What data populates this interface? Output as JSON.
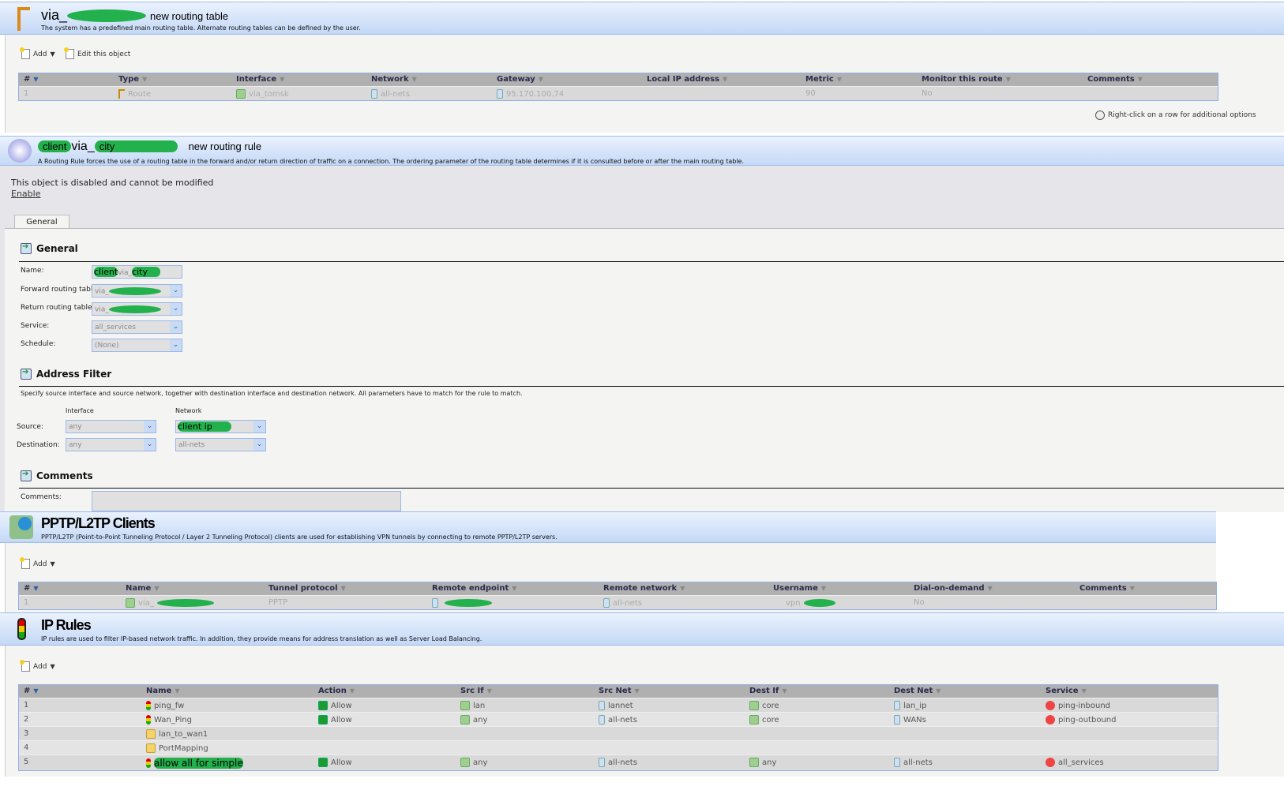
{
  "routing_table": {
    "title_prefix": "via_",
    "title_suffix": "new routing table",
    "description": "The system has a predefined main routing table. Alternate routing tables can be defined by the user.",
    "toolbar": {
      "add": "Add",
      "edit": "Edit this object"
    },
    "columns": [
      "#",
      "Type",
      "Interface",
      "Network",
      "Gateway",
      "Local IP address",
      "Metric",
      "Monitor this route",
      "Comments"
    ],
    "rows": [
      [
        "1",
        "Route",
        "via_tomsk",
        "all-nets",
        "95.170.100.74",
        "",
        "90",
        "No",
        ""
      ]
    ],
    "hint": "Right-click on a row for additional options"
  },
  "routing_rule": {
    "title_a": "client",
    "title_b": "via_",
    "title_c": "city",
    "title_suffix": "new routing rule",
    "description": "A Routing Rule forces the use of a routing table in the forward and/or return direction of traffic on a connection. The ordering parameter of the routing table determines if it is consulted before or after the main routing table.",
    "disabled_msg": "This object is disabled and cannot be modified",
    "enable_link": "Enable",
    "tab": "General",
    "general": {
      "heading": "General",
      "name_label": "Name:",
      "name_value_a": "client",
      "name_value_b": "via_",
      "name_value_c": "city",
      "fwd_label": "Forward routing table:",
      "fwd_value": "via_",
      "ret_label": "Return routing table:",
      "ret_value": "via_",
      "service_label": "Service:",
      "service_value": "all_services",
      "schedule_label": "Schedule:",
      "schedule_value": "(None)"
    },
    "address_filter": {
      "heading": "Address Filter",
      "description": "Specify source interface and source network, together with destination interface and destination network. All parameters have to match for the rule to match.",
      "interface_col": "Interface",
      "network_col": "Network",
      "source_label": "Source:",
      "source_if": "any",
      "source_net": "client ip",
      "dest_label": "Destination:",
      "dest_if": "any",
      "dest_net": "all-nets"
    },
    "comments": {
      "heading": "Comments",
      "label": "Comments:",
      "value": ""
    }
  },
  "pptp": {
    "title": "PPTP/L2TP Clients",
    "description": "PPTP/L2TP (Point-to-Point Tunneling Protocol / Layer 2 Tunneling Protocol) clients are used for establishing VPN tunnels by connecting to remote PPTP/L2TP servers.",
    "toolbar": {
      "add": "Add"
    },
    "columns": [
      "#",
      "Name",
      "Tunnel protocol",
      "Remote endpoint",
      "Remote network",
      "Username",
      "Dial-on-demand",
      "Comments"
    ],
    "rows": [
      [
        "1",
        "via_",
        "PPTP",
        "",
        "all-nets",
        "vpn",
        "No",
        ""
      ]
    ]
  },
  "ip_rules": {
    "title": "IP Rules",
    "description": "IP rules are used to filter IP-based network traffic. In addition, they provide means for address translation as well as Server Load Balancing.",
    "toolbar": {
      "add": "Add"
    },
    "columns": [
      "#",
      "Name",
      "Action",
      "Src If",
      "Src Net",
      "Dest If",
      "Dest Net",
      "Service"
    ],
    "rows": [
      [
        "1",
        "ping_fw",
        "Allow",
        "lan",
        "lannet",
        "core",
        "lan_ip",
        "ping-inbound"
      ],
      [
        "2",
        "Wan_Ping",
        "Allow",
        "any",
        "all-nets",
        "core",
        "WANs",
        "ping-outbound"
      ],
      [
        "3",
        "lan_to_wan1",
        "",
        "",
        "",
        "",
        "",
        ""
      ],
      [
        "4",
        "PortMapping",
        "",
        "",
        "",
        "",
        "",
        ""
      ],
      [
        "5",
        "allow all for simple",
        "Allow",
        "any",
        "all-nets",
        "any",
        "all-nets",
        "all_services"
      ]
    ]
  },
  "colors": {
    "header_top": "#eaf2fd",
    "header_bottom": "#c4d8f6",
    "redaction": "#22b14c",
    "table_header": "#b0b0b0"
  }
}
